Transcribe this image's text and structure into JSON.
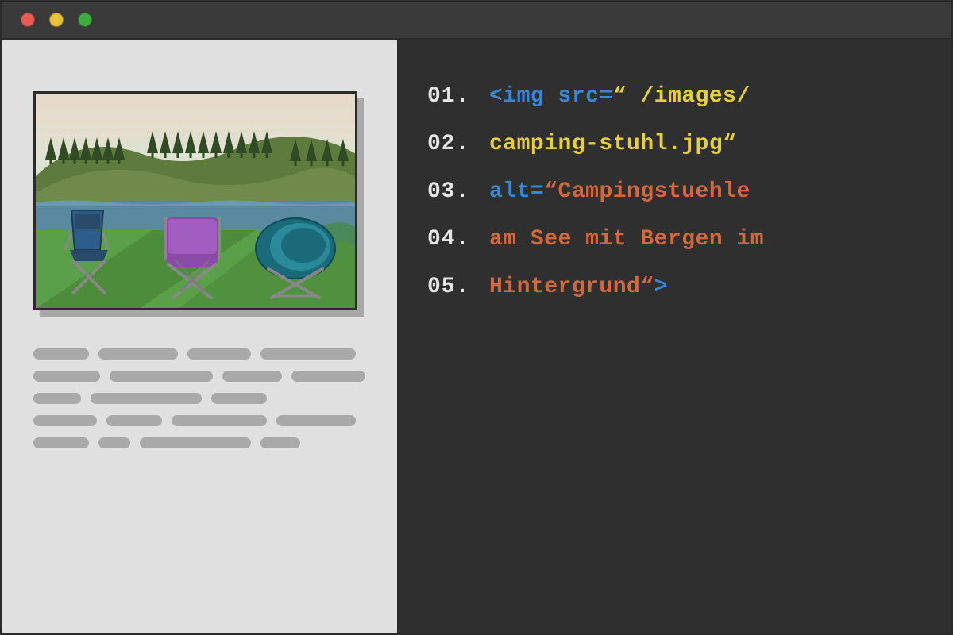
{
  "titlebar": {
    "controls": [
      "close",
      "minimize",
      "maximize"
    ]
  },
  "code": {
    "lines": [
      {
        "num": "01.",
        "tokens": [
          {
            "t": "<",
            "c": "blue"
          },
          {
            "t": "img ",
            "c": "blue"
          },
          {
            "t": "src=",
            "c": "blue"
          },
          {
            "t": "“ ",
            "c": "yellow"
          },
          {
            "t": "/images/",
            "c": "yellow"
          }
        ]
      },
      {
        "num": "02.",
        "tokens": [
          {
            "t": "camping-stuhl.jpg",
            "c": "yellow"
          },
          {
            "t": "“",
            "c": "yellow"
          }
        ]
      },
      {
        "num": "03.",
        "tokens": [
          {
            "t": "alt=",
            "c": "blue"
          },
          {
            "t": "“",
            "c": "orange"
          },
          {
            "t": "Campingstuehle",
            "c": "orange"
          }
        ]
      },
      {
        "num": "04.",
        "tokens": [
          {
            "t": "am See mit Bergen im",
            "c": "orange"
          }
        ]
      },
      {
        "num": "05.",
        "tokens": [
          {
            "t": "Hintergrund",
            "c": "orange"
          },
          {
            "t": "“",
            "c": "orange"
          },
          {
            "t": ">",
            "c": "blue"
          }
        ]
      }
    ]
  },
  "image": {
    "description": "Campingstuehle am See mit Bergen im Hintergrund",
    "sky_top": "#e8d9c8",
    "sky_bottom": "#d8e8d8",
    "mountain1": "#5e7a3d",
    "mountain2": "#6f8a4a",
    "tree_color": "#2f4a24",
    "water": "#5a8aa0",
    "grass": "#5aa048",
    "grass_shadow": "#4a8a3a",
    "chair_blue_dark": "#2a4a6a",
    "chair_blue": "#2d5d8a",
    "chair_purple": "#a35cc0",
    "chair_purple_dark": "#8a4aa8",
    "chair_teal": "#1a6a7a",
    "chair_teal_light": "#2a8a9a",
    "frame_gray": "#888",
    "tent": "#4a8a5a"
  },
  "placeholder_lines": [
    [
      70,
      100,
      80,
      120
    ],
    [
      90,
      140,
      80,
      100
    ],
    [
      60,
      140,
      70
    ],
    [
      80,
      70,
      120,
      100
    ],
    [
      70,
      40,
      140,
      50
    ]
  ]
}
